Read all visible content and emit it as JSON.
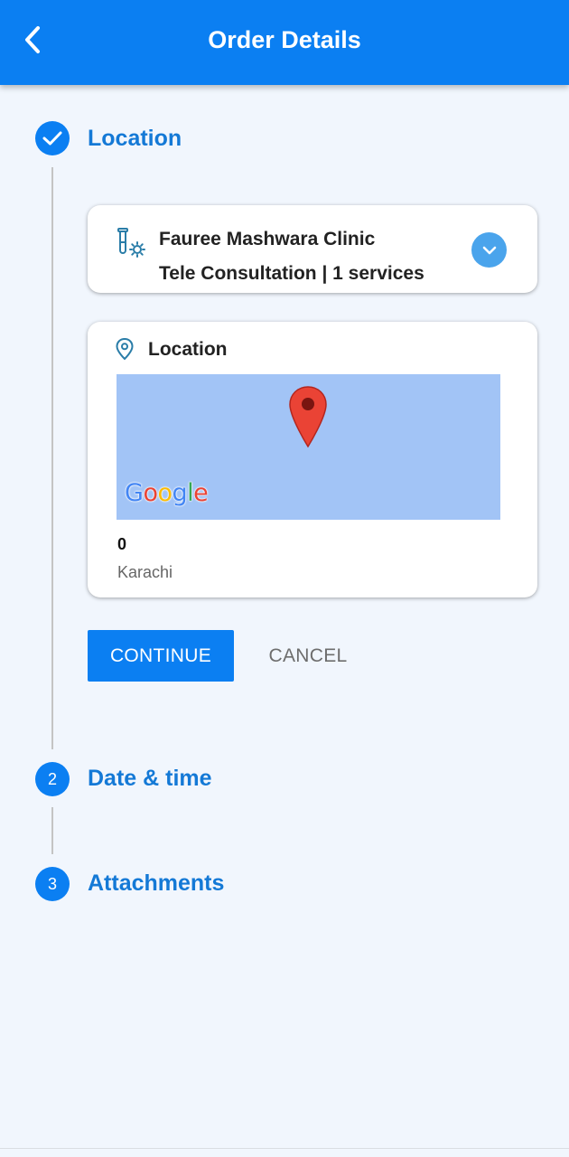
{
  "header": {
    "title": "Order Details",
    "back_icon": "chevron-left-icon"
  },
  "colors": {
    "primary": "#0b7ff2",
    "step_title": "#1479d6",
    "background": "#f1f6fd",
    "map": "#a2c4f6",
    "expand_button": "#4aa4ec"
  },
  "steps": [
    {
      "marker": "check-icon",
      "title": "Location",
      "completed": true
    },
    {
      "number": "2",
      "title": "Date & time",
      "completed": false
    },
    {
      "number": "3",
      "title": "Attachments",
      "completed": false
    }
  ],
  "clinic_card": {
    "icon": "lab-test-tube-icon",
    "name": "Fauree Mashwara Clinic",
    "services": "Tele Consultation | 1  services",
    "expand_icon": "chevron-down-icon"
  },
  "location_card": {
    "icon": "location-pin-icon",
    "title": "Location",
    "map_logo": "Google",
    "address_number": "0",
    "city": "Karachi"
  },
  "actions": {
    "continue_label": "CONTINUE",
    "cancel_label": "CANCEL"
  }
}
